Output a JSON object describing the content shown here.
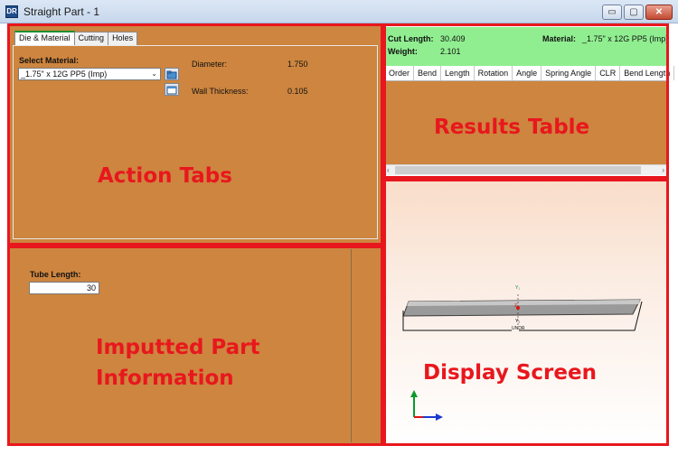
{
  "window": {
    "title": "Straight Part - 1",
    "app_icon": "DR",
    "controls": {
      "minimize": "▭",
      "maximize": "▢",
      "close": "✕"
    }
  },
  "tabs": [
    {
      "label": "Die & Material",
      "active": true
    },
    {
      "label": "Cutting",
      "active": false
    },
    {
      "label": "Holes",
      "active": false
    }
  ],
  "die_material": {
    "select_label": "Select Material:",
    "selected_material": "_1.75\" x 12G PP5 (Imp)",
    "diameter_label": "Diameter:",
    "diameter_value": "1.750",
    "wall_label": "Wall Thickness:",
    "wall_value": "0.105"
  },
  "part_info": {
    "tube_length_label": "Tube Length:",
    "tube_length_value": "30"
  },
  "results": {
    "cut_length_label": "Cut Length:",
    "cut_length_value": "30.409",
    "weight_label": "Weight:",
    "weight_value": "2.101",
    "material_label": "Material:",
    "material_value": "_1.75\" x 12G PP5 (Imp)",
    "columns": [
      "Order",
      "Bend",
      "Length",
      "Rotation",
      "Angle",
      "Spring Angle",
      "CLR",
      "Bend Length"
    ]
  },
  "annotations": {
    "action_tabs": "Action Tabs",
    "imputted_part_line1": "Imputted Part",
    "imputted_part_line2": "Information",
    "results_table": "Results Table",
    "display_screen": "Display Screen"
  },
  "viewport": {
    "y_top_label": "Y₁",
    "y_bottom_label": "Y₁",
    "z_label": "Z",
    "base_label": "UNDR"
  },
  "colors": {
    "panel": "#cd853f",
    "annotation": "#e8171d",
    "results_header": "#90ee90"
  }
}
